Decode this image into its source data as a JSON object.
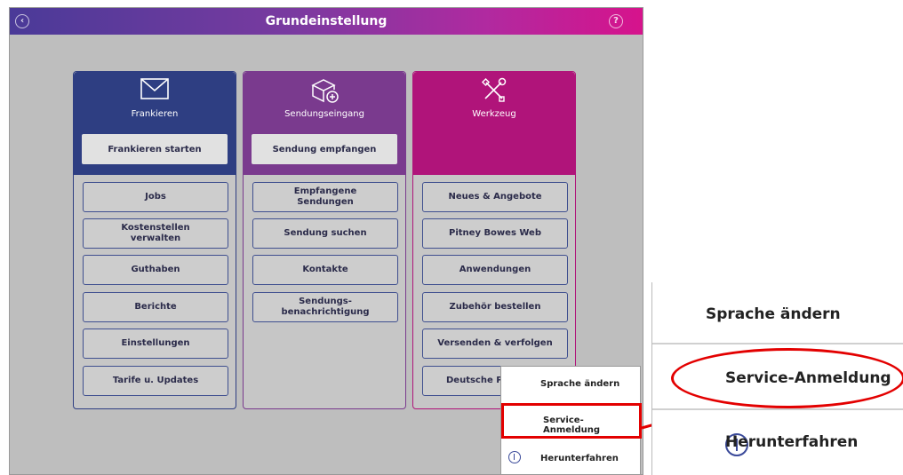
{
  "titlebar": {
    "title": "Grundeinstellung",
    "back_icon": "back-icon",
    "help_icon": "help-icon"
  },
  "colors": {
    "frankieren": "#2e3e82",
    "sendungseingang": "#7a3a8e",
    "werkzeug": "#b0147a",
    "highlight": "#e30000"
  },
  "columns": [
    {
      "title": "Frankieren",
      "icon": "envelope-icon",
      "primary_button": "Frankieren starten",
      "buttons": [
        "Jobs",
        "Kostenstellen verwalten",
        "Guthaben",
        "Berichte",
        "Einstellungen",
        "Tarife u. Updates"
      ]
    },
    {
      "title": "Sendungseingang",
      "icon": "package-add-icon",
      "primary_button": "Sendung empfangen",
      "buttons": [
        "Empfangene Sendungen",
        "Sendung suchen",
        "Kontakte",
        "Sendungs-benachrichtigung"
      ]
    },
    {
      "title": "Werkzeug",
      "icon": "tools-icon",
      "buttons": [
        "Neues & Angebote",
        "Pitney Bowes Web",
        "Anwendungen",
        "Zubehör bestellen",
        "Versenden & verfolgen",
        "Deutsche Po"
      ]
    }
  ],
  "popup_menu": {
    "items": [
      "Sprache ändern",
      "Service-Anmeldung",
      "Herunterfahren"
    ],
    "highlighted": "Service-Anmeldung"
  },
  "zoom_inset": {
    "items": [
      "Sprache ändern",
      "Service-Anmeldung",
      "Herunterfahren"
    ]
  }
}
